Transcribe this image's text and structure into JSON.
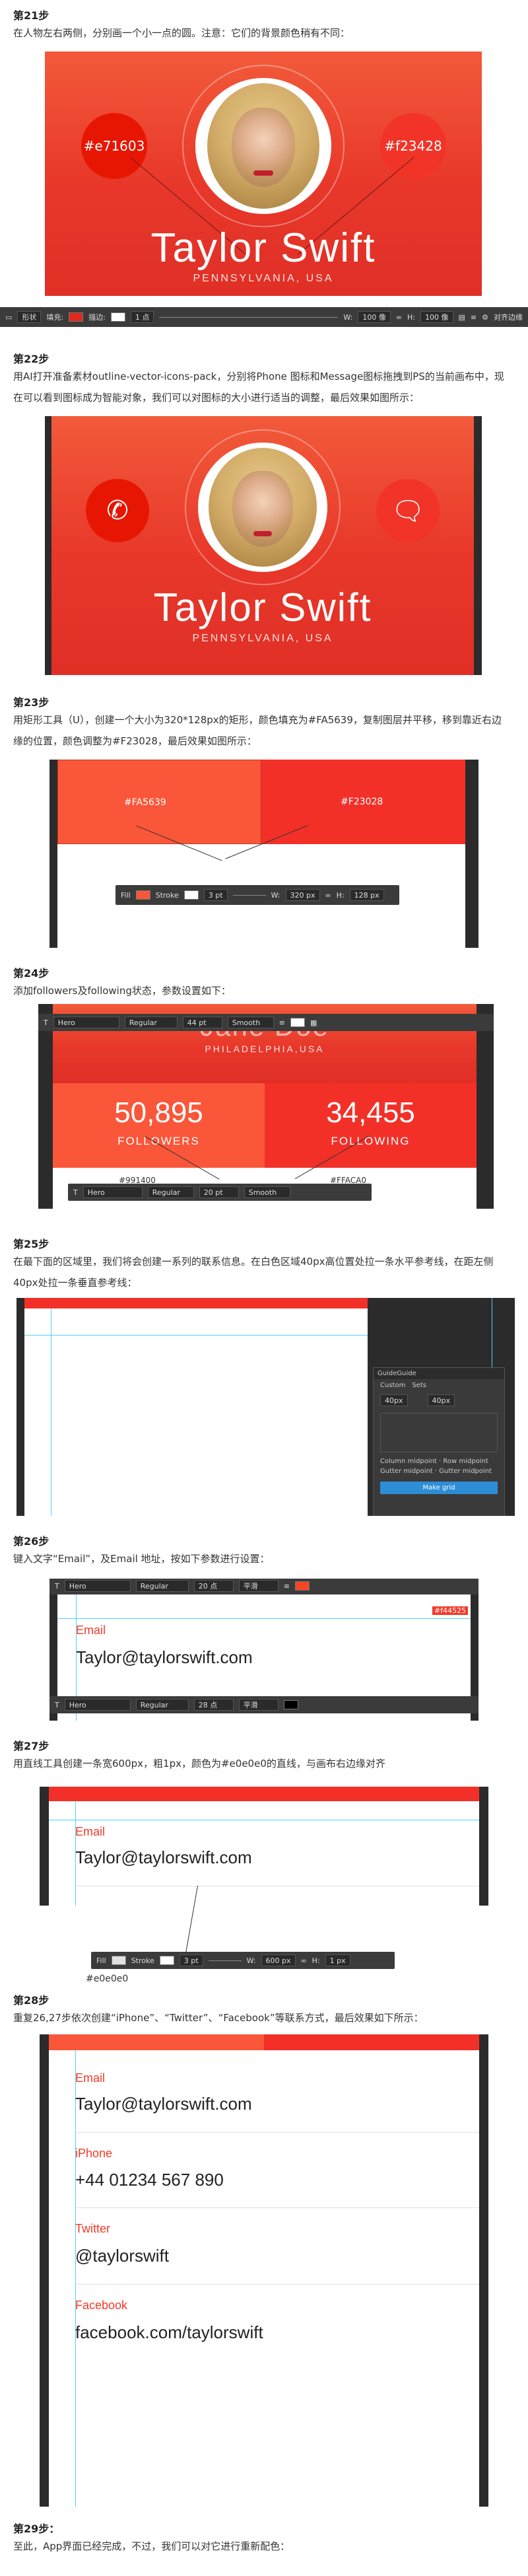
{
  "steps": [
    {
      "title": "第21步",
      "desc": "在人物左右两侧，分别画一个小一点的圆。注意：它们的背景颜色稍有不同："
    },
    {
      "title": "第22步",
      "desc": "用AI打开准备素材outline-vector-icons-pack，分别将Phone 图标和Message图标拖拽到PS的当前画布中，现在可以看到图标成为智能对象，我们可以对图标的大小进行适当的调整，最后效果如图所示："
    },
    {
      "title": "第23步",
      "desc": "用矩形工具（U），创建一个大小为320*128px的矩形，颜色填充为#FA5639，复制图层并平移，移到靠近右边缘的位置，颜色调整为#F23028，最后效果如图所示："
    },
    {
      "title": "第24步",
      "desc": "添加followers及following状态，参数设置如下："
    },
    {
      "title": "第25步",
      "desc": "在最下面的区域里，我们将会创建一系列的联系信息。在白色区域40px高位置处拉一条水平参考线，在距左侧40px处拉一条垂直参考线："
    },
    {
      "title": "第26步",
      "desc": "键入文字“Email”，及Email 地址，按如下参数进行设置："
    },
    {
      "title": "第27步",
      "desc": "用直线工具创建一条宽600px，粗1px，颜色为#e0e0e0的直线，与画布右边缘对齐"
    },
    {
      "title": "第28步",
      "desc": "重复26,27步依次创建“iPhone”、“Twitter”、“Facebook”等联系方式，最后效果如下所示："
    },
    {
      "title": "第29步：",
      "desc": "至此，App界面已经完成，不过，我们可以对它进行重新配色："
    }
  ],
  "hero": {
    "name": "Taylor Swift",
    "location": "PENNSYLVANIA,  USA",
    "left_badge": "#e71603",
    "right_badge": "#f23428"
  },
  "rects": {
    "left_hex": "#FA5639",
    "right_hex": "#F23028"
  },
  "stats": {
    "name": "Jane Doe",
    "location": "PHILADELPHIA,USA",
    "followers_value": "50,895",
    "followers_label": "FOLLOWERS",
    "following_value": "34,455",
    "following_label": "FOLLOWING",
    "left_hex": "#991400",
    "right_hex": "#FFACA0"
  },
  "toolbar21": {
    "label1": "形状",
    "label2": "填充:",
    "label3": "描边:",
    "stroke": "1 点",
    "w": "100 像",
    "h": "100 像",
    "right": "对齐边缘"
  },
  "toolbar23": {
    "fill": "Fill",
    "stroke": "Stroke",
    "pt": "3 pt",
    "w": "320 px",
    "h": "128 px"
  },
  "toolbar24a": {
    "font": "Hero",
    "style": "Regular",
    "size": "44 pt",
    "aa": "Smooth"
  },
  "toolbar24b": {
    "font": "Hero",
    "style": "Regular",
    "size": "20 pt",
    "aa": "Smooth"
  },
  "toolbar26a": {
    "font": "Hero",
    "style": "Regular",
    "size": "20 点",
    "aa": "平滑",
    "hex": "#f44525"
  },
  "toolbar26b": {
    "font": "Hero",
    "style": "Regular",
    "size": "28 点",
    "aa": "平滑"
  },
  "toolbar27": {
    "fill": "Fill",
    "stroke": "Stroke",
    "pt": "3 pt",
    "w": "600 px",
    "h": "1 px",
    "hex": "#e0e0e0"
  },
  "guide_panel": {
    "title": "GuideGuide",
    "tab1": "Custom",
    "tab2": "Sets",
    "val1": "40px",
    "val2": "40px",
    "opt1": "Column midpoint",
    "opt2": "Row midpoint",
    "opt3": "Gutter midpoint",
    "opt4": "Gutter midpoint",
    "button": "Make grid"
  },
  "contact": {
    "email_label": "Email",
    "email_value": "Taylor@taylorswift.com",
    "iphone_label": "iPhone",
    "iphone_value": "+44 01234 567 890",
    "twitter_label": "Twitter",
    "twitter_value": "@taylorswift",
    "facebook_label": "Facebook",
    "facebook_value": "facebook.com/taylorswift"
  },
  "colors": {
    "red1": "#fa5639",
    "red2": "#f23028",
    "ink": "#222222"
  }
}
